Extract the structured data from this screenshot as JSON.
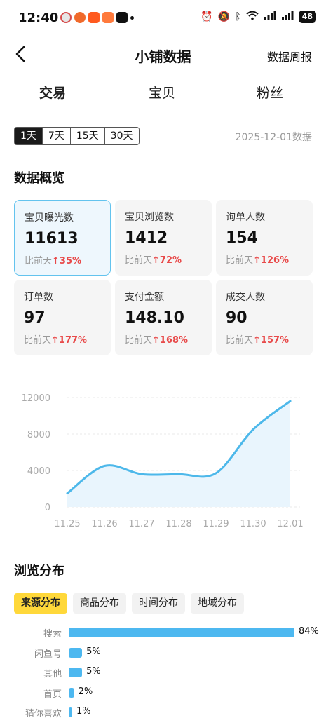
{
  "status": {
    "time": "12:40",
    "battery": "48"
  },
  "nav": {
    "title": "小铺数据",
    "action": "数据周报"
  },
  "tabs": [
    {
      "label": "交易"
    },
    {
      "label": "宝贝"
    },
    {
      "label": "粉丝"
    }
  ],
  "range": {
    "options": [
      "1天",
      "7天",
      "15天",
      "30天"
    ],
    "selected": "1天",
    "note": "2025-12-01数据"
  },
  "overview": {
    "title": "数据概览",
    "compare_prefix": "比前天",
    "cards": [
      {
        "label": "宝贝曝光数",
        "value": "11613",
        "change": "35%"
      },
      {
        "label": "宝贝浏览数",
        "value": "1412",
        "change": "72%"
      },
      {
        "label": "询单人数",
        "value": "154",
        "change": "126%"
      },
      {
        "label": "订单数",
        "value": "97",
        "change": "177%"
      },
      {
        "label": "支付金额",
        "value": "148.10",
        "change": "168%"
      },
      {
        "label": "成交人数",
        "value": "90",
        "change": "157%"
      }
    ]
  },
  "chart_data": {
    "type": "area",
    "x": [
      "11.25",
      "11.26",
      "11.27",
      "11.28",
      "11.29",
      "11.30",
      "12.01"
    ],
    "values": [
      1500,
      4500,
      3600,
      3600,
      3700,
      8500,
      11613
    ],
    "ylim": [
      0,
      12000
    ],
    "yticks": [
      0,
      4000,
      8000,
      12000
    ],
    "grid": true,
    "color": "#4db8ea",
    "fill": "#e9f5fd"
  },
  "browse": {
    "title": "浏览分布",
    "tabs": [
      "来源分布",
      "商品分布",
      "时间分布",
      "地域分布"
    ],
    "active_tab": "来源分布",
    "rows": [
      {
        "label": "搜索",
        "pct": 84,
        "text": "84%"
      },
      {
        "label": "闲鱼号",
        "pct": 5,
        "text": "5%"
      },
      {
        "label": "其他",
        "pct": 5,
        "text": "5%"
      },
      {
        "label": "首页",
        "pct": 2,
        "text": "2%"
      },
      {
        "label": "猜你喜欢",
        "pct": 1,
        "text": "1%"
      }
    ]
  },
  "colors": {
    "accent": "#ffd83a",
    "bar": "#4db8f0",
    "up": "#e84a4a"
  }
}
